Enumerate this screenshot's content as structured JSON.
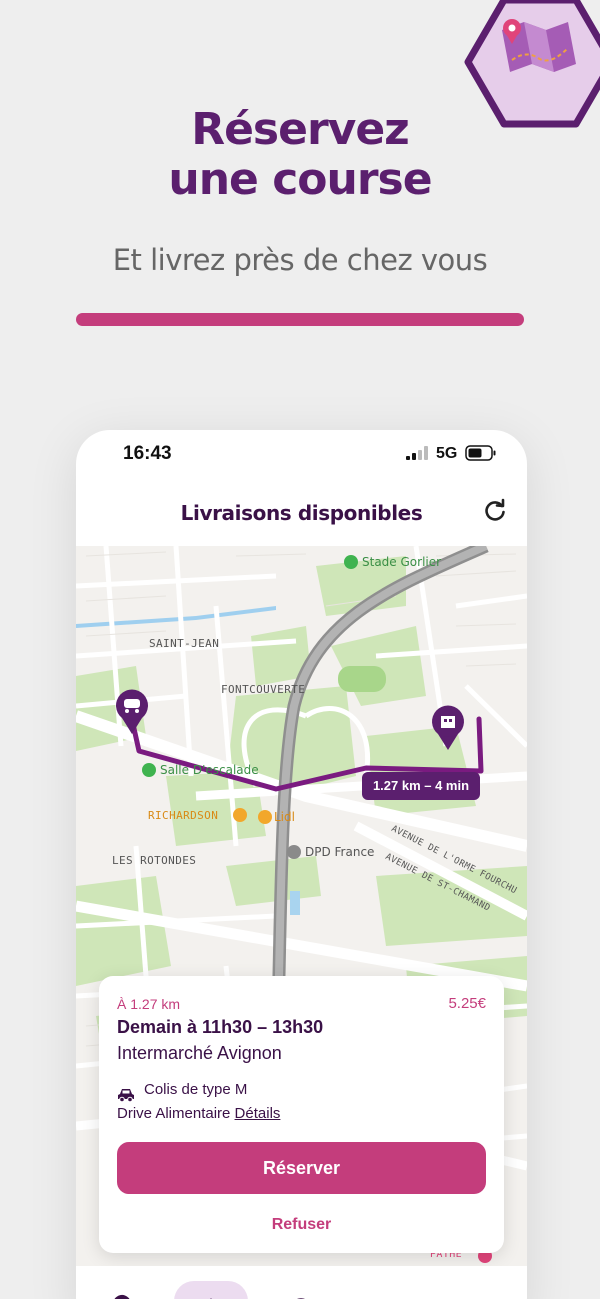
{
  "promo": {
    "headline_line1": "Réservez",
    "headline_line2": "une course",
    "subline": "Et livrez près de chez vous",
    "badge_icon": "map-pin-icon"
  },
  "status_bar": {
    "time": "16:43",
    "network": "5G"
  },
  "header": {
    "title": "Livraisons disponibles",
    "refresh_icon": "refresh-icon"
  },
  "map": {
    "labels": {
      "stade": "Stade Gorlier",
      "saint_jean": "SAINT-JEAN",
      "fontcouverte": "FONTCOUVERTE",
      "salle": "Salle D'escalade",
      "richardson": "RICHARDSON",
      "lidl": "Lidl",
      "dpd": "DPD France",
      "rotondes": "LES ROTONDES",
      "avenue1": "AVENUE DE L'ORME FOURCHU",
      "avenue2": "AVENUE DE ST-CHAMAND",
      "pathe": "PATHÉ"
    },
    "route_info": "1.27 km – 4 min"
  },
  "card": {
    "distance": "À 1.27 km",
    "price": "5.25€",
    "time_window": "Demain à 11h30 – 13h30",
    "store": "Intermarché Avignon",
    "package": "Colis de type M",
    "category": "Drive Alimentaire",
    "details_link": "Détails",
    "reserve_label": "Réserver",
    "refuse_label": "Refuser"
  },
  "colors": {
    "brand_purple": "#5b1f6e",
    "accent_pink": "#c43d7c",
    "route": "#7a1b80"
  }
}
